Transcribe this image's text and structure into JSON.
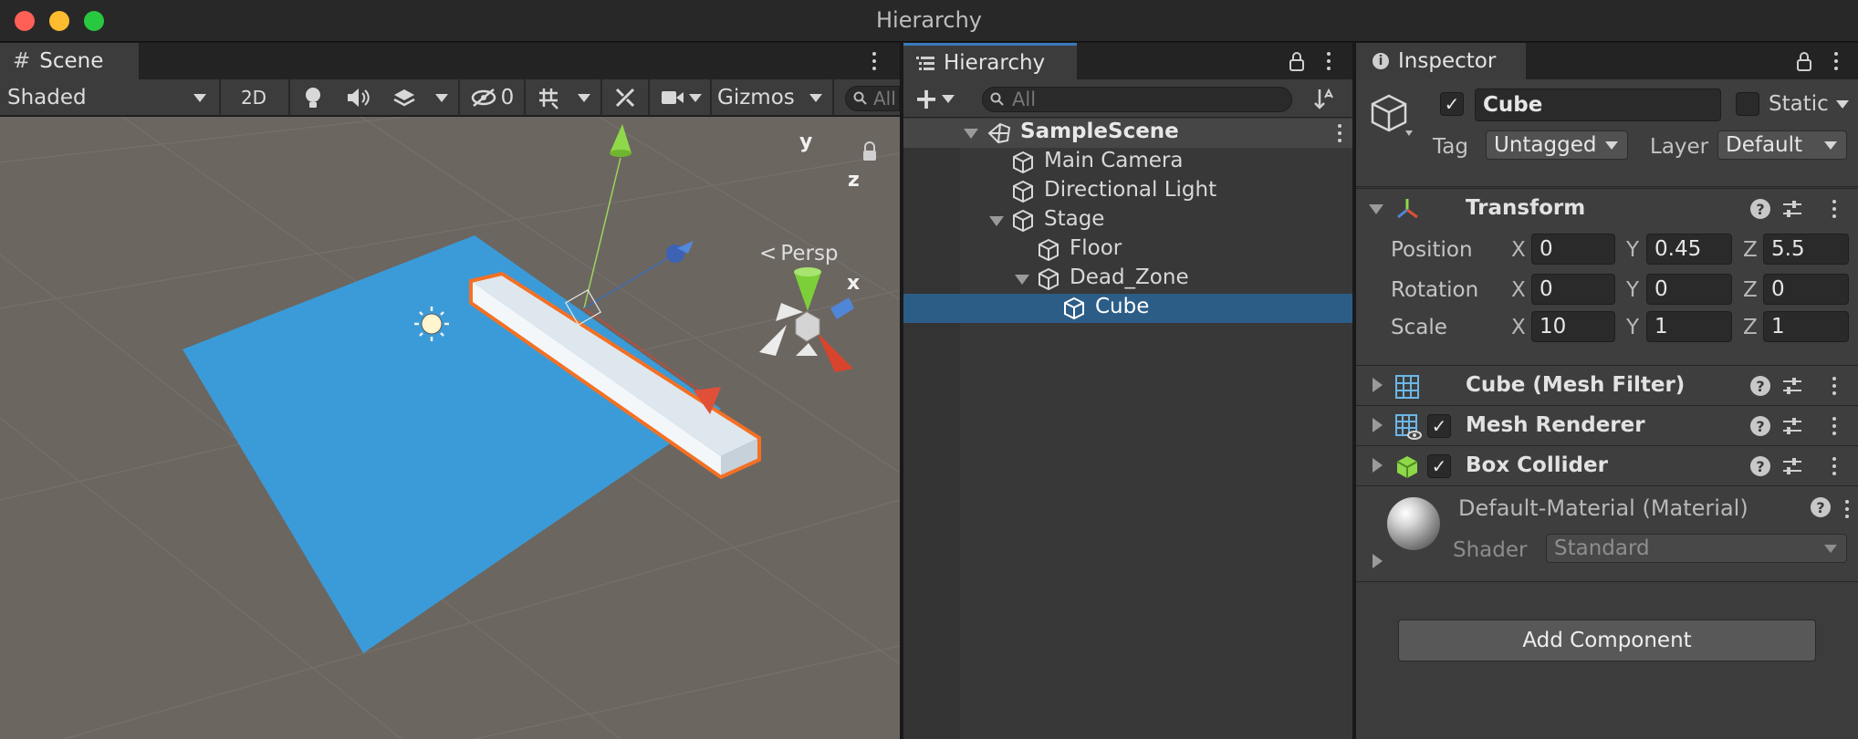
{
  "window": {
    "title": "Hierarchy"
  },
  "scene": {
    "tab_label": "Scene",
    "draw_mode": "Shaded",
    "mode_2d": "2D",
    "hidden_count": "0",
    "gizmos_label": "Gizmos",
    "search_placeholder": "All",
    "projection_label": "Persp",
    "gizmo_axes": {
      "y": "y",
      "z": "z",
      "x": "x"
    },
    "colors": {
      "floor": "#3b9bd8",
      "background": "#6b6660",
      "selection": "#f37024"
    }
  },
  "hierarchy": {
    "tab_label": "Hierarchy",
    "search_placeholder": "All",
    "scene_name": "SampleScene",
    "items": [
      {
        "label": "Main Camera",
        "depth": 1,
        "expanded": null,
        "selected": false
      },
      {
        "label": "Directional Light",
        "depth": 1,
        "expanded": null,
        "selected": false
      },
      {
        "label": "Stage",
        "depth": 1,
        "expanded": true,
        "selected": false
      },
      {
        "label": "Floor",
        "depth": 2,
        "expanded": null,
        "selected": false
      },
      {
        "label": "Dead_Zone",
        "depth": 2,
        "expanded": true,
        "selected": false
      },
      {
        "label": "Cube",
        "depth": 3,
        "expanded": null,
        "selected": true
      }
    ]
  },
  "inspector": {
    "tab_label": "Inspector",
    "object_name": "Cube",
    "active": true,
    "static_label": "Static",
    "static": false,
    "tag_label": "Tag",
    "tag_value": "Untagged",
    "layer_label": "Layer",
    "layer_value": "Default",
    "transform": {
      "title": "Transform",
      "rows": [
        {
          "label": "Position",
          "x": "0",
          "y": "0.45",
          "z": "5.5"
        },
        {
          "label": "Rotation",
          "x": "0",
          "y": "0",
          "z": "0"
        },
        {
          "label": "Scale",
          "x": "10",
          "y": "1",
          "z": "1"
        }
      ],
      "axis_labels": {
        "x": "X",
        "y": "Y",
        "z": "Z"
      }
    },
    "components": [
      {
        "title": "Cube (Mesh Filter)",
        "has_toggle": false,
        "enabled": null,
        "icon": "mesh-filter-icon"
      },
      {
        "title": "Mesh Renderer",
        "has_toggle": true,
        "enabled": true,
        "icon": "mesh-renderer-icon"
      },
      {
        "title": "Box Collider",
        "has_toggle": true,
        "enabled": true,
        "icon": "box-collider-icon"
      }
    ],
    "material": {
      "name": "Default-Material (Material)",
      "shader_label": "Shader",
      "shader_value": "Standard"
    },
    "add_component_label": "Add Component"
  }
}
